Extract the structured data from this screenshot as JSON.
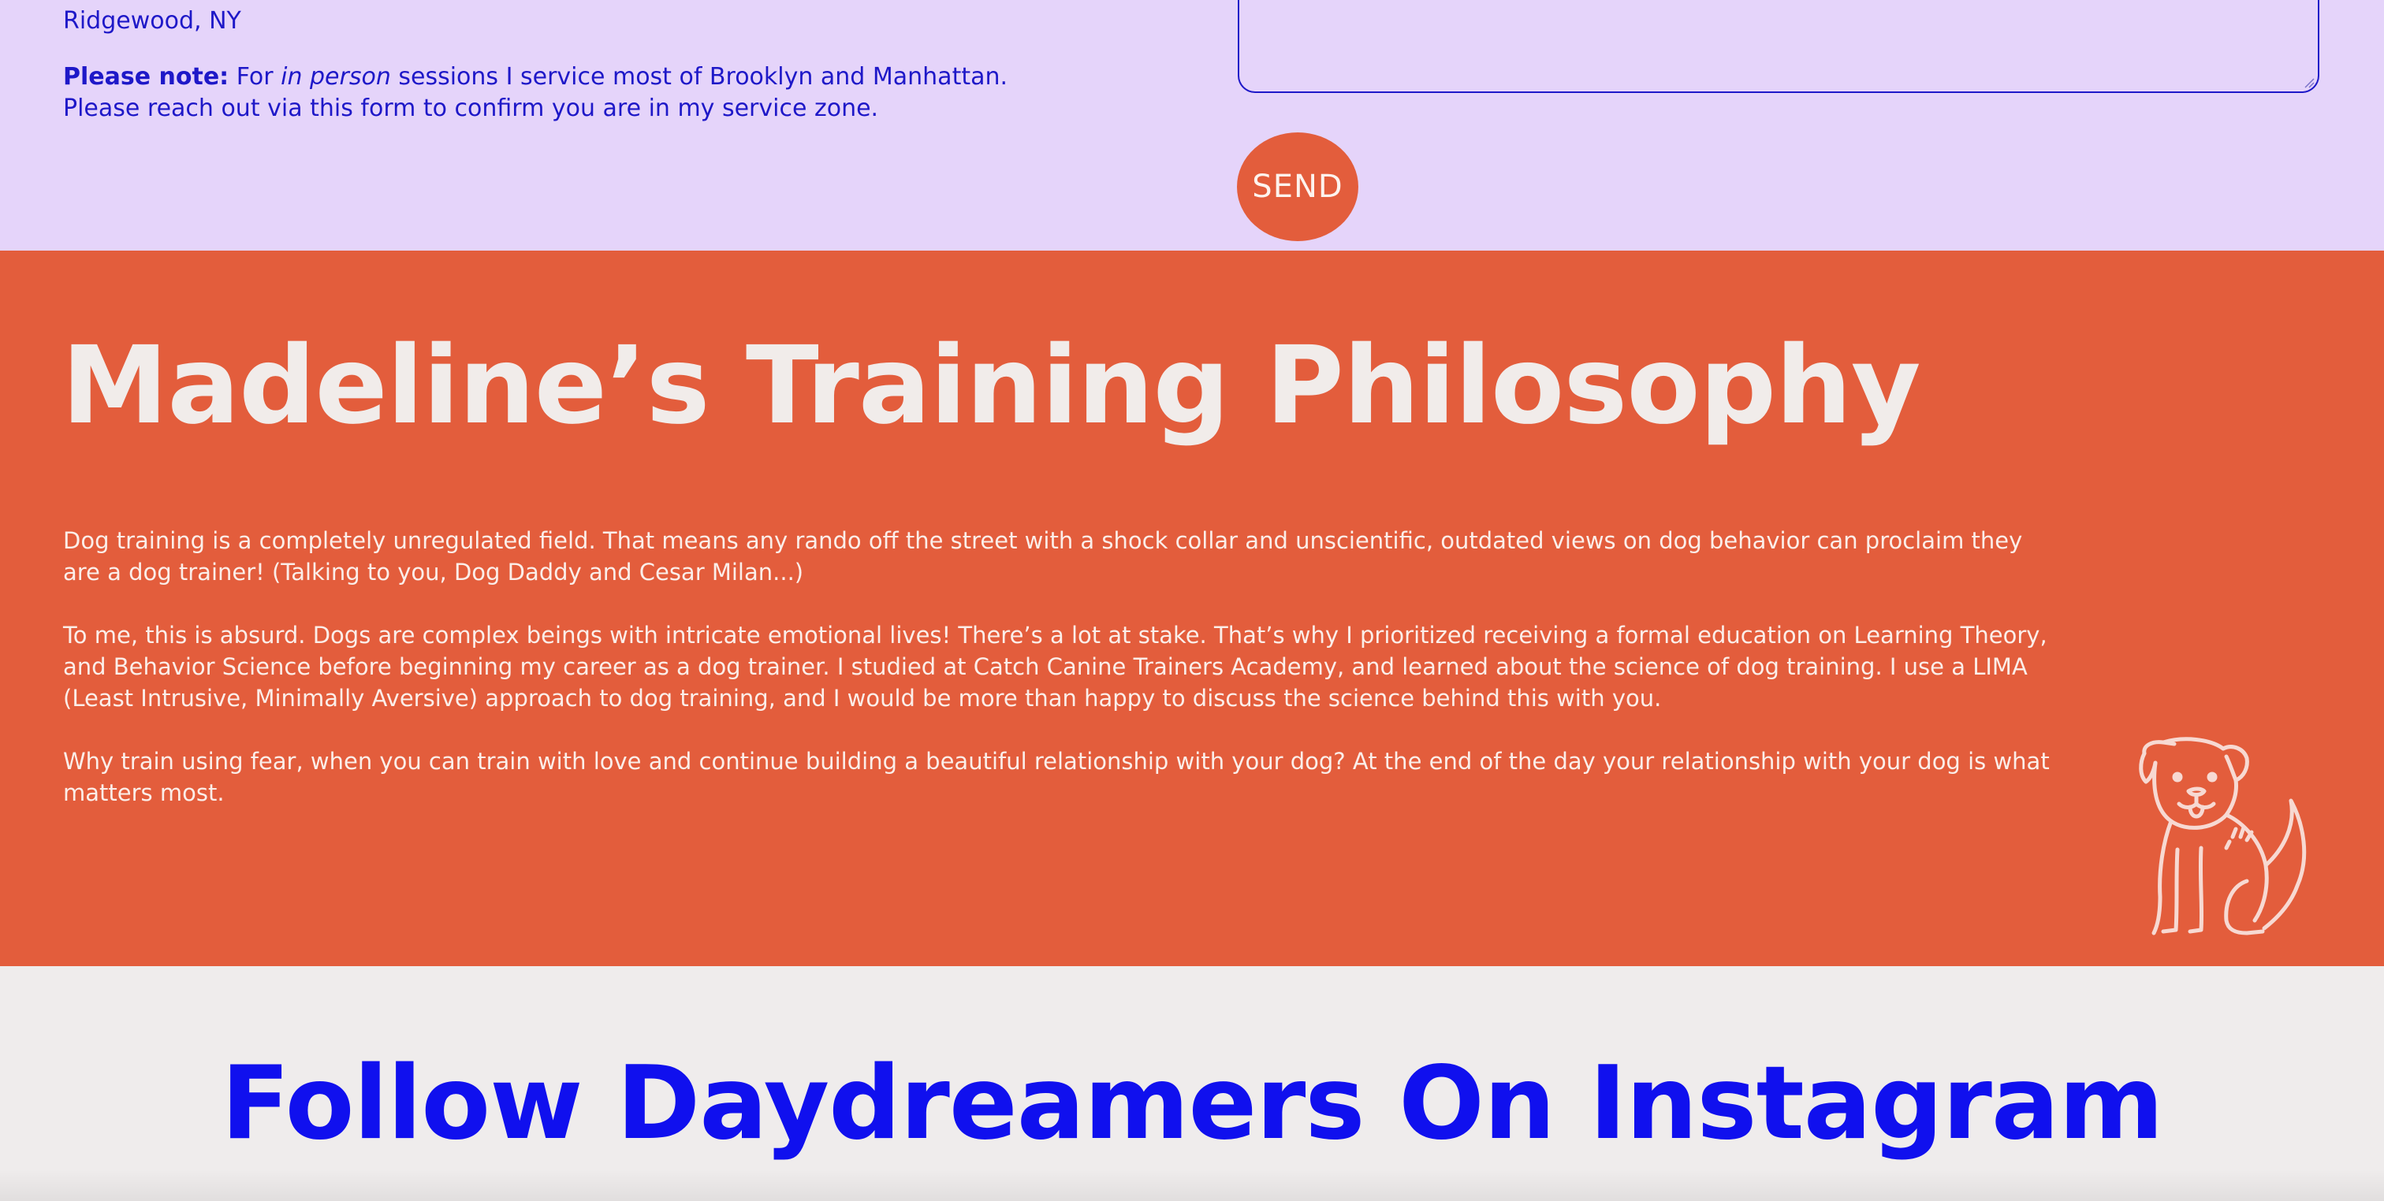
{
  "contact": {
    "location": "Ridgewood, NY",
    "note_label": "Please note:",
    "note_prefix": " For ",
    "note_emphasis": "in person",
    "note_suffix": " sessions I service most of Brooklyn and Manhattan. Please reach out via this form to confirm you are in my service zone.",
    "message_placeholder": "",
    "send_label": "SEND"
  },
  "philosophy": {
    "title": "Madeline’s Training Philosophy",
    "paragraphs": [
      "Dog training is a completely unregulated field. That means any rando off the street with a shock collar and unscientific, outdated views on dog behavior can proclaim they are a dog trainer! (Talking to you, Dog Daddy and Cesar Milan...)",
      "To me, this is absurd. Dogs are complex beings with intricate emotional lives! There’s a lot at stake. That’s why I prioritized receiving a formal education on Learning Theory, and Behavior Science before beginning my career as a dog trainer. I studied at Catch Canine Trainers Academy, and learned about the science of dog training. I use a LIMA (Least Intrusive, Minimally Aversive) approach to dog training, and I would be more than happy to discuss the science behind this with you.",
      "Why train using fear, when you can train with love and continue building a beautiful relationship with your dog? At the end of the day your relationship with your dog is what matters most."
    ],
    "illustration_icon": "dog-illustration-icon"
  },
  "instagram": {
    "title": "Follow Daydreamers On Instagram"
  },
  "colors": {
    "lavender": "#e5d4fa",
    "orange": "#e35d3c",
    "blue": "#1010ee",
    "cream": "#f1ecea"
  }
}
